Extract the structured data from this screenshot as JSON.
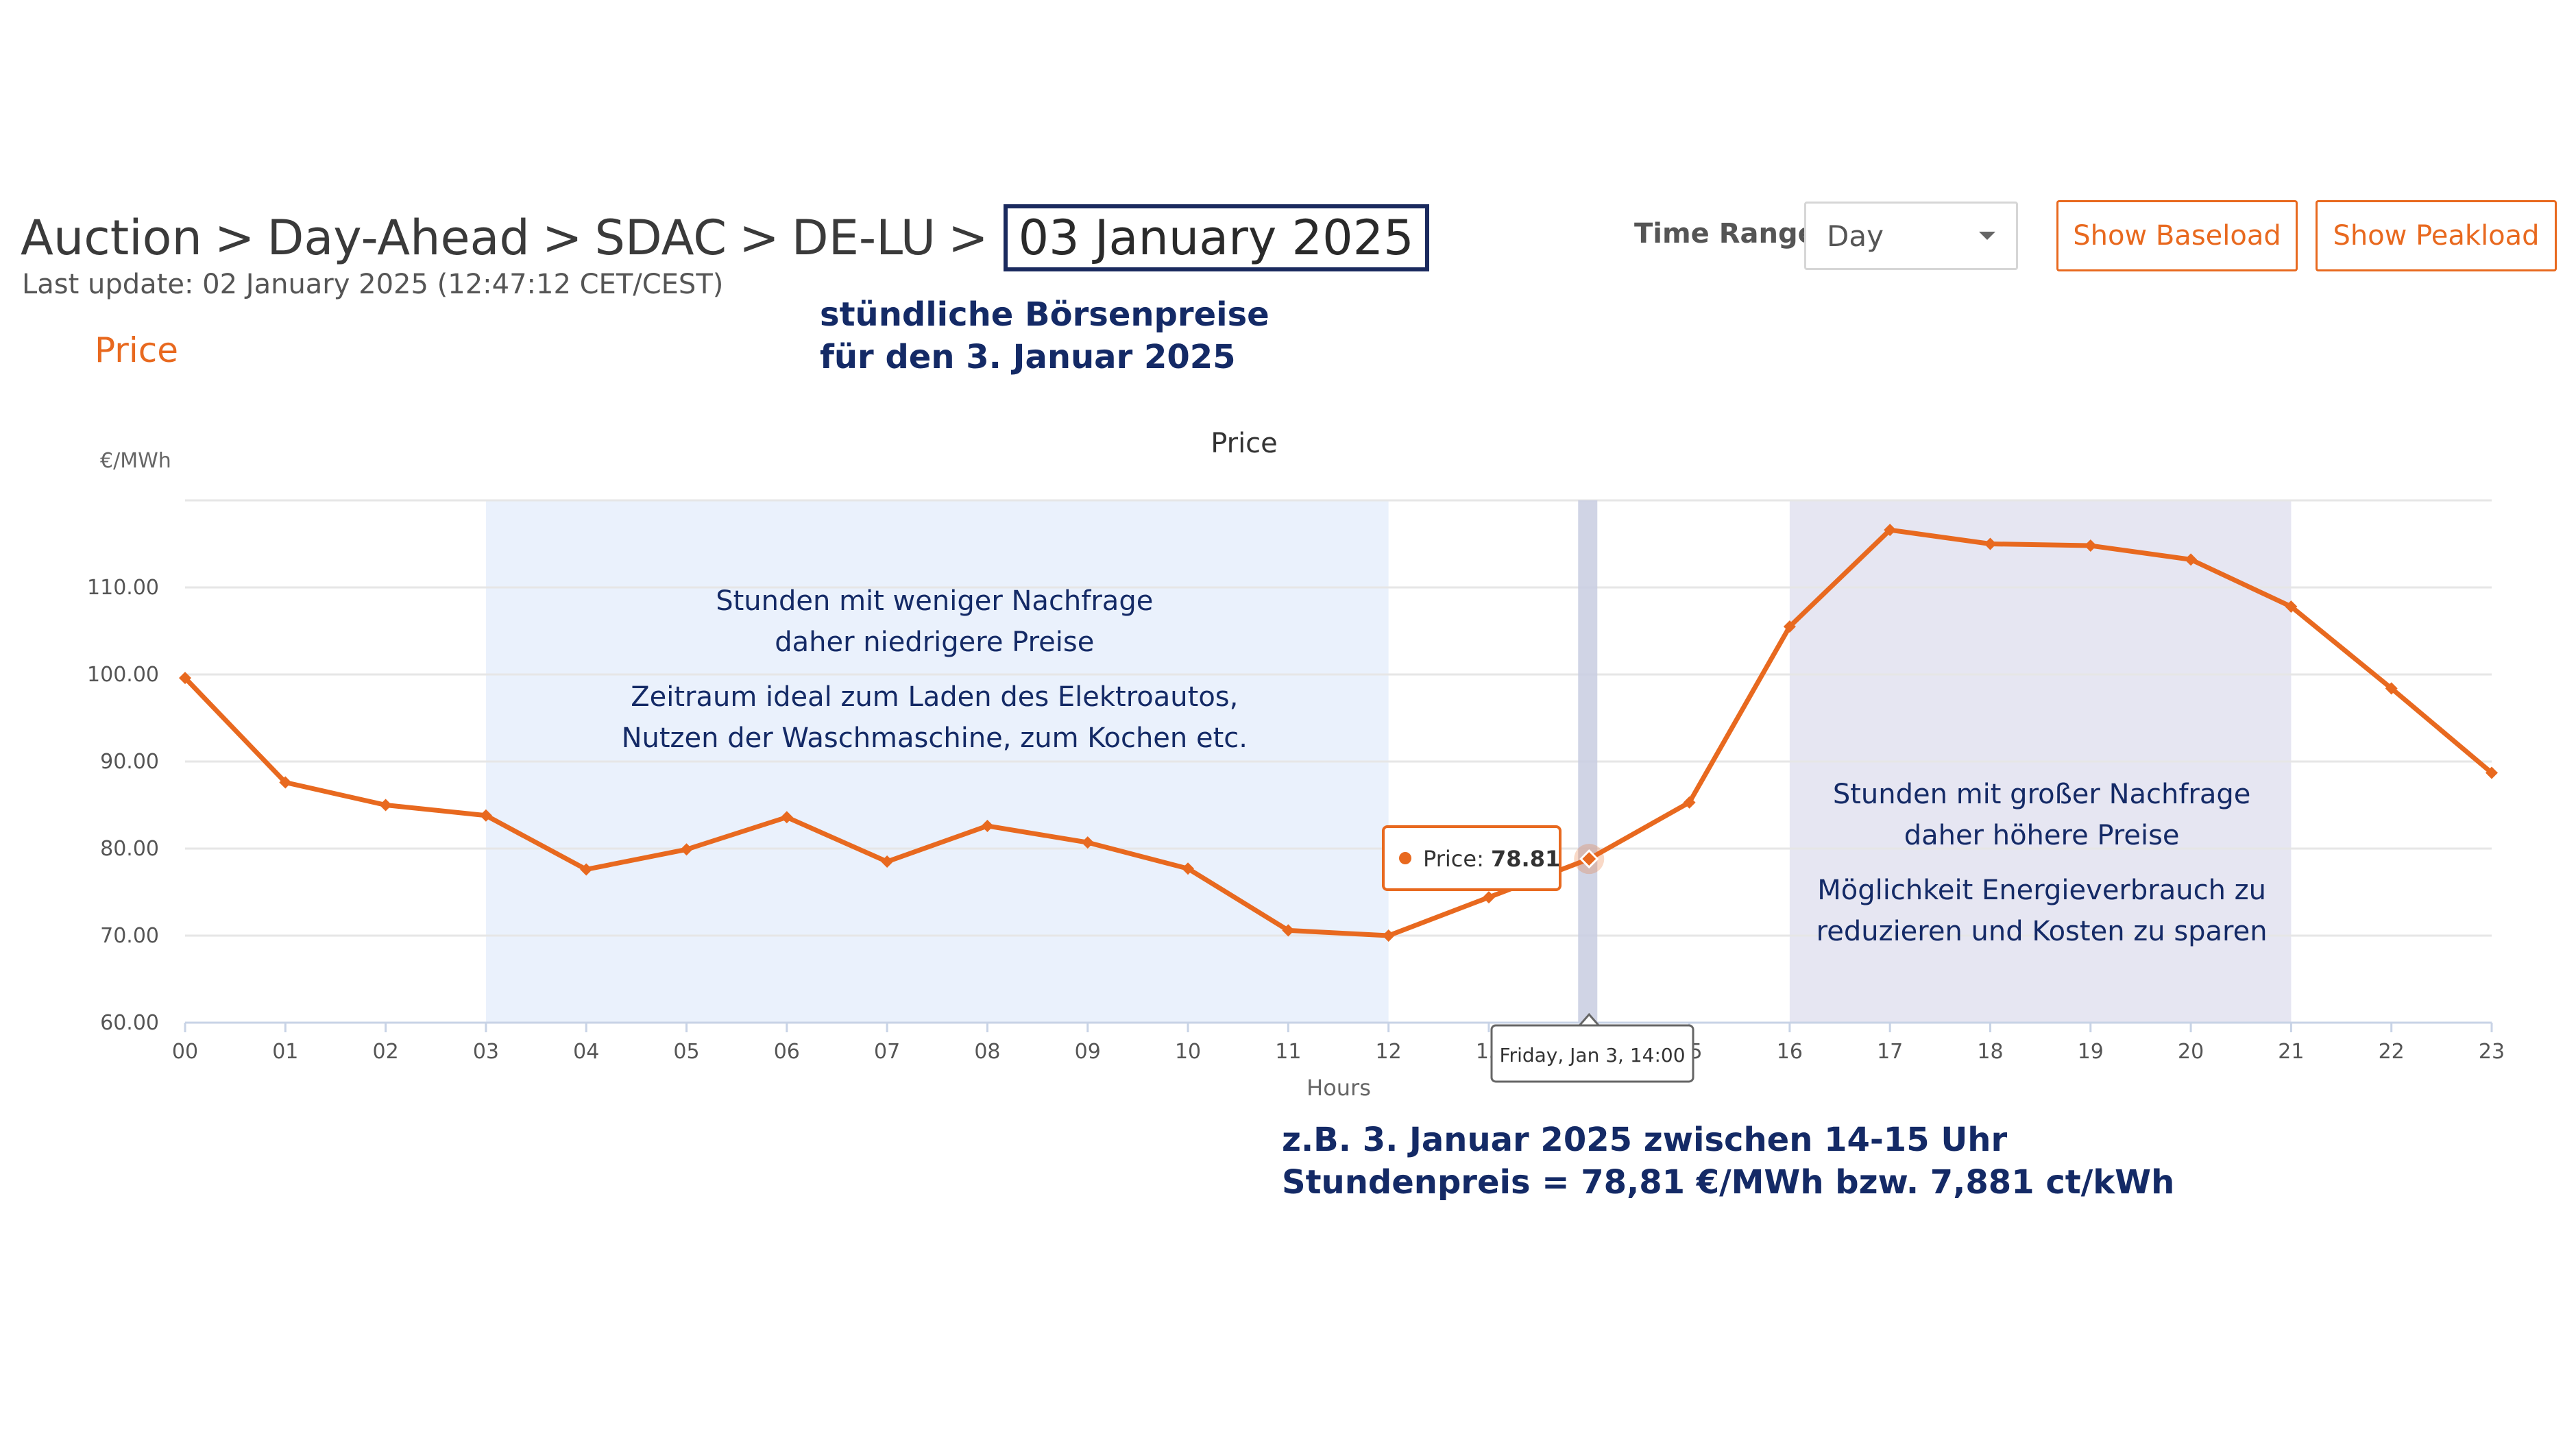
{
  "header": {
    "breadcrumb": [
      "Auction",
      "Day-Ahead",
      "SDAC",
      "DE-LU"
    ],
    "separator": ">",
    "selected_date": "03 January 2025",
    "last_update": "Last update: 02 January 2025 (12:47:12 CET/CEST)",
    "section_title": "Price"
  },
  "controls": {
    "time_range_label": "Time Range",
    "time_range_value": "Day",
    "baseload_label": "Show Baseload",
    "peakload_label": "Show Peakload"
  },
  "annotations": {
    "title_line1": "stündliche Börsenpreise",
    "title_line2": "für den 3. Januar 2025",
    "low_demand_line1": "Stunden mit weniger Nachfrage",
    "low_demand_line2": "daher niedrigere Preise",
    "low_demand_line3": "Zeitraum ideal zum Laden des Elektroautos,",
    "low_demand_line4": "Nutzen der Waschmaschine, zum Kochen etc.",
    "high_demand_line1": "Stunden mit großer Nachfrage",
    "high_demand_line2": "daher höhere Preise",
    "high_demand_line3": "Möglichkeit Energieverbrauch zu",
    "high_demand_line4": "reduzieren und Kosten zu sparen",
    "example_line1": "z.B. 3. Januar 2025 zwischen 14-15 Uhr",
    "example_line2": "Stundenpreis = 78,81 €/MWh bzw. 7,881 ct/kWh"
  },
  "tooltip": {
    "label": "Price",
    "value": "78.81",
    "time_label": "Friday, Jan 3, 14:00",
    "hour_index": 14
  },
  "chart_data": {
    "type": "line",
    "title": "Price",
    "xlabel": "Hours",
    "ylabel": "€/MWh",
    "categories": [
      "00",
      "01",
      "02",
      "03",
      "04",
      "05",
      "06",
      "07",
      "08",
      "09",
      "10",
      "11",
      "12",
      "13",
      "14",
      "15",
      "16",
      "17",
      "18",
      "19",
      "20",
      "21",
      "22",
      "23"
    ],
    "series": [
      {
        "name": "Price",
        "values": [
          99.6,
          87.6,
          85.0,
          83.8,
          77.6,
          79.9,
          83.6,
          78.5,
          82.6,
          80.7,
          77.7,
          70.6,
          70.0,
          74.4,
          78.81,
          85.3,
          105.5,
          116.6,
          115.0,
          114.8,
          113.2,
          107.8,
          98.4,
          88.7
        ]
      }
    ],
    "yticks": [
      "60.00",
      "70.00",
      "80.00",
      "90.00",
      "100.00",
      "110.00"
    ],
    "ylim": [
      60,
      120
    ],
    "grid": true,
    "low_band_hours": [
      3,
      12
    ],
    "high_band_hours": [
      16,
      21
    ],
    "colors": {
      "line": "#e8691f",
      "low_band": "#eaf1fc",
      "high_band": "#e6e6f2",
      "grid": "#e6e6e6",
      "hover_band": "#c8cce0"
    }
  }
}
